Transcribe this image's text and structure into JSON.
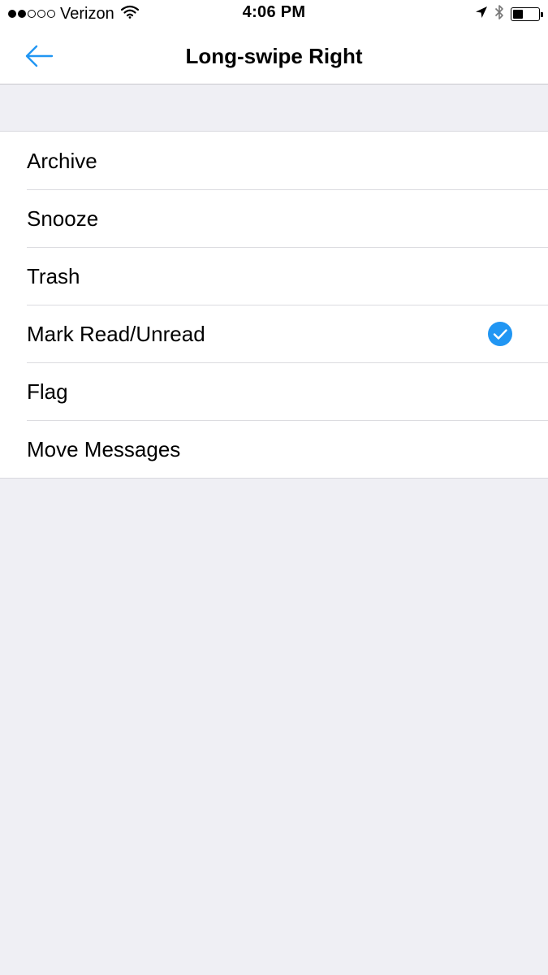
{
  "status_bar": {
    "signal_strength": "2 of 5",
    "carrier": "Verizon",
    "time": "4:06 PM",
    "battery_level": 0.4
  },
  "nav": {
    "title": "Long-swipe Right",
    "back_icon": "arrow-left-icon"
  },
  "options": [
    {
      "label": "Archive",
      "selected": false
    },
    {
      "label": "Snooze",
      "selected": false
    },
    {
      "label": "Trash",
      "selected": false
    },
    {
      "label": "Mark Read/Unread",
      "selected": true
    },
    {
      "label": "Flag",
      "selected": false
    },
    {
      "label": "Move Messages",
      "selected": false
    }
  ],
  "colors": {
    "accent": "#2196f3",
    "background": "#efeff4",
    "row_background": "#ffffff",
    "separator": "#dcdce0"
  }
}
